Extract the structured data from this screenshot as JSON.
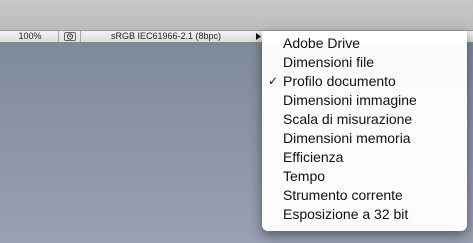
{
  "status_bar": {
    "zoom": "100%",
    "profile": "sRGB IEC61966-2.1 (8bpc)",
    "nav_icon": "clock-icon",
    "menu_arrow_icon": "triangle-right-icon"
  },
  "menu": {
    "check_mark": "✓",
    "items": [
      {
        "label": "Adobe Drive",
        "checked": false
      },
      {
        "label": "Dimensioni file",
        "checked": false
      },
      {
        "label": "Profilo documento",
        "checked": true
      },
      {
        "label": "Dimensioni immagine",
        "checked": false
      },
      {
        "label": "Scala di misurazione",
        "checked": false
      },
      {
        "label": "Dimensioni memoria",
        "checked": false
      },
      {
        "label": "Efficienza",
        "checked": false
      },
      {
        "label": "Tempo",
        "checked": false
      },
      {
        "label": "Strumento corrente",
        "checked": false
      },
      {
        "label": "Esposizione a 32 bit",
        "checked": false
      }
    ]
  }
}
